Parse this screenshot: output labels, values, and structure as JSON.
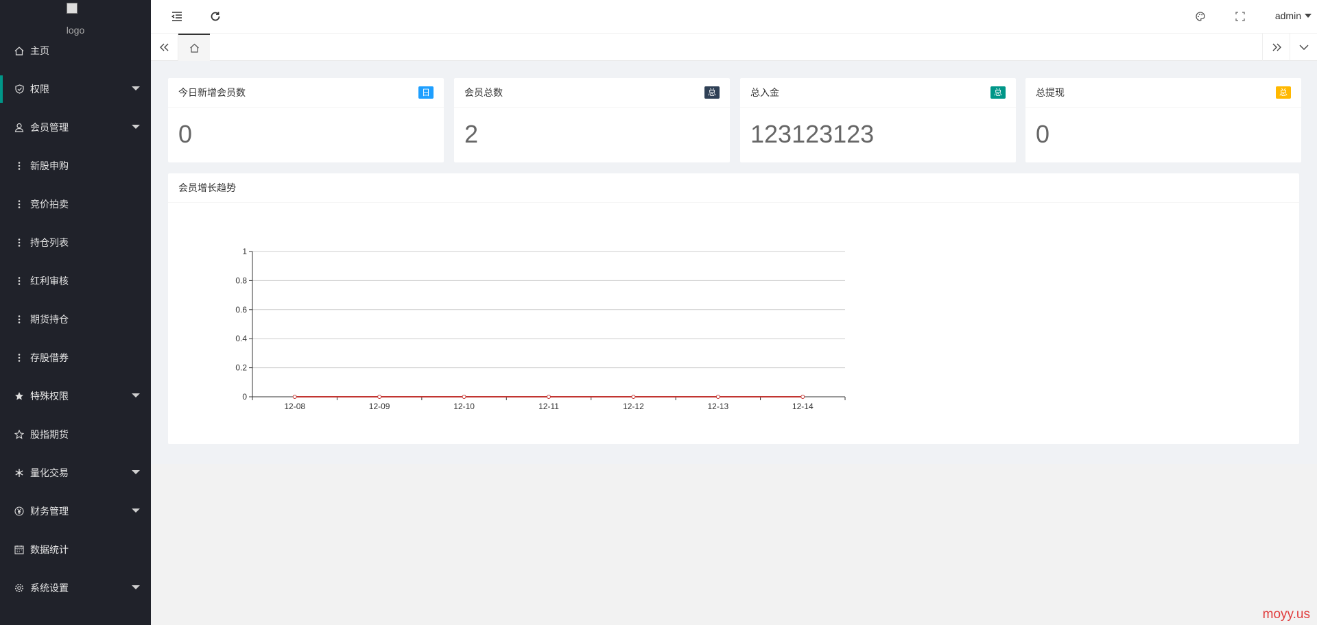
{
  "sidebar": {
    "logo_alt": "logo",
    "items": [
      {
        "label": "主页",
        "icon": "home-icon",
        "has_caret": false
      },
      {
        "label": "权限",
        "icon": "shield-icon",
        "has_caret": true
      },
      {
        "label": "会员管理",
        "icon": "user-icon",
        "has_caret": true
      },
      {
        "label": "新股申购",
        "icon": "dots-icon",
        "has_caret": false
      },
      {
        "label": "竞价拍卖",
        "icon": "dots-icon",
        "has_caret": false
      },
      {
        "label": "持仓列表",
        "icon": "dots-icon",
        "has_caret": false
      },
      {
        "label": "红利审核",
        "icon": "dots-icon",
        "has_caret": false
      },
      {
        "label": "期货持仓",
        "icon": "dots-icon",
        "has_caret": false
      },
      {
        "label": "存股借券",
        "icon": "dots-icon",
        "has_caret": false
      },
      {
        "label": "特殊权限",
        "icon": "star-filled-icon",
        "has_caret": true
      },
      {
        "label": "股指期货",
        "icon": "star-outline-icon",
        "has_caret": false
      },
      {
        "label": "量化交易",
        "icon": "snowflake-icon",
        "has_caret": true
      },
      {
        "label": "财务管理",
        "icon": "yen-icon",
        "has_caret": true
      },
      {
        "label": "数据统计",
        "icon": "calendar-icon",
        "has_caret": false
      },
      {
        "label": "系统设置",
        "icon": "gear-icon",
        "has_caret": true
      }
    ]
  },
  "header": {
    "user": "admin"
  },
  "stats": [
    {
      "title": "今日新增会员数",
      "badge": "日",
      "badge_color": "#1e9fff",
      "value": "0"
    },
    {
      "title": "会员总数",
      "badge": "总",
      "badge_color": "#2f4056",
      "value": "2"
    },
    {
      "title": "总入金",
      "badge": "总",
      "badge_color": "#009688",
      "value": "123123123"
    },
    {
      "title": "总提现",
      "badge": "总",
      "badge_color": "#ffb800",
      "value": "0"
    }
  ],
  "chart": {
    "title": "会员增长趋势"
  },
  "chart_data": {
    "type": "line",
    "categories": [
      "12-08",
      "12-09",
      "12-10",
      "12-11",
      "12-12",
      "12-13",
      "12-14"
    ],
    "series": [
      {
        "values": [
          0,
          0,
          0,
          0,
          0,
          0,
          0
        ],
        "color": "#c23531"
      }
    ],
    "ylim": [
      0,
      1
    ],
    "yticks": [
      "0",
      "0.2",
      "0.4",
      "0.6",
      "0.8",
      "1"
    ],
    "grid": true
  },
  "watermark": "moyy.us"
}
